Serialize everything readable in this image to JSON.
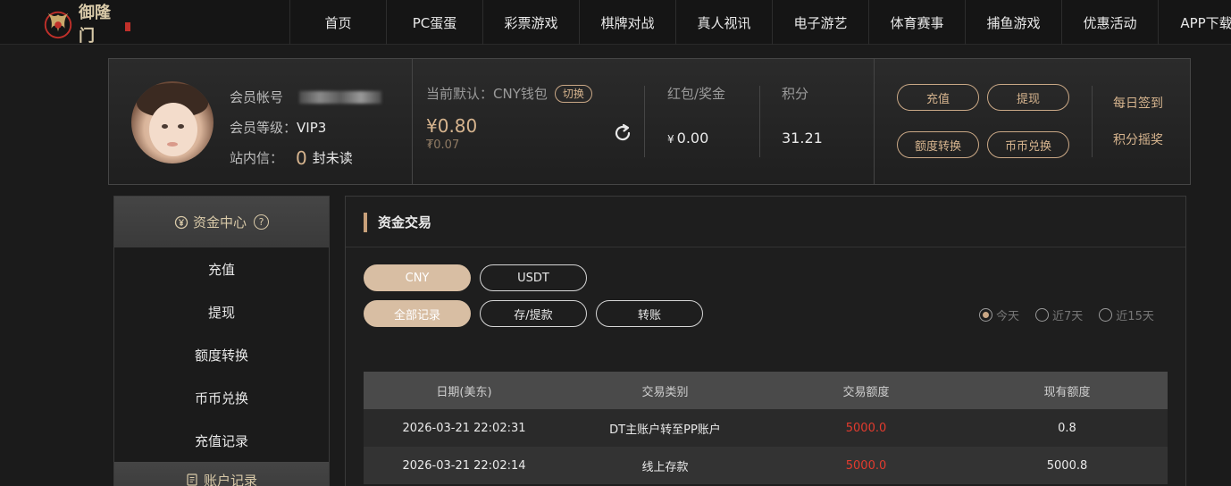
{
  "brand": {
    "logo_text": "御隆门"
  },
  "nav": {
    "items": [
      {
        "label": "首页"
      },
      {
        "label": "PC蛋蛋"
      },
      {
        "label": "彩票游戏"
      },
      {
        "label": "棋牌对战"
      },
      {
        "label": "真人视讯"
      },
      {
        "label": "电子游艺"
      },
      {
        "label": "体育赛事"
      },
      {
        "label": "捕鱼游戏"
      },
      {
        "label": "优惠活动"
      },
      {
        "label": "APP下载"
      }
    ]
  },
  "profile": {
    "account_label": "会员帐号",
    "level_label": "会员等级：",
    "level_value": "VIP3",
    "inbox_label": "站内信：",
    "unread_count": "0",
    "unread_suffix": "封未读"
  },
  "wallet": {
    "default_label": "当前默认：CNY钱包",
    "switch_label": "切换",
    "amount": "¥0.80",
    "sub_amount": "₮0.07"
  },
  "bonus": {
    "label": "红包/奖金",
    "currency": "¥",
    "value": "0.00"
  },
  "points": {
    "label": "积分",
    "value": "31.21"
  },
  "actions": {
    "deposit": "充值",
    "withdraw": "提现",
    "transfer": "额度转换",
    "exchange": "币币兑换",
    "daily_checkin": "每日签到",
    "points_lottery": "积分摇奖"
  },
  "sidebar": {
    "header": "资金中心",
    "help": "?",
    "items": [
      {
        "label": "充值"
      },
      {
        "label": "提现"
      },
      {
        "label": "额度转换"
      },
      {
        "label": "币币兑换"
      },
      {
        "label": "充值记录"
      }
    ],
    "header2": "账户记录"
  },
  "main": {
    "title": "资金交易",
    "currency_tabs": [
      "CNY",
      "USDT"
    ],
    "record_tabs": [
      "全部记录",
      "存/提款",
      "转账"
    ],
    "ranges": [
      "今天",
      "近7天",
      "近15天"
    ],
    "columns": [
      "日期(美东)",
      "交易类别",
      "交易额度",
      "现有额度"
    ],
    "rows": [
      {
        "date": "2026-03-21 22:02:31",
        "type": "DT主账户转至PP账户",
        "amount": "5000.0",
        "balance": "0.8"
      },
      {
        "date": "2026-03-21 22:02:14",
        "type": "线上存款",
        "amount": "5000.0",
        "balance": "5000.8"
      }
    ]
  },
  "colors": {
    "accent": "#d6b48e",
    "active_pill": "#d8bea3",
    "amount_red": "#e23b2e"
  }
}
